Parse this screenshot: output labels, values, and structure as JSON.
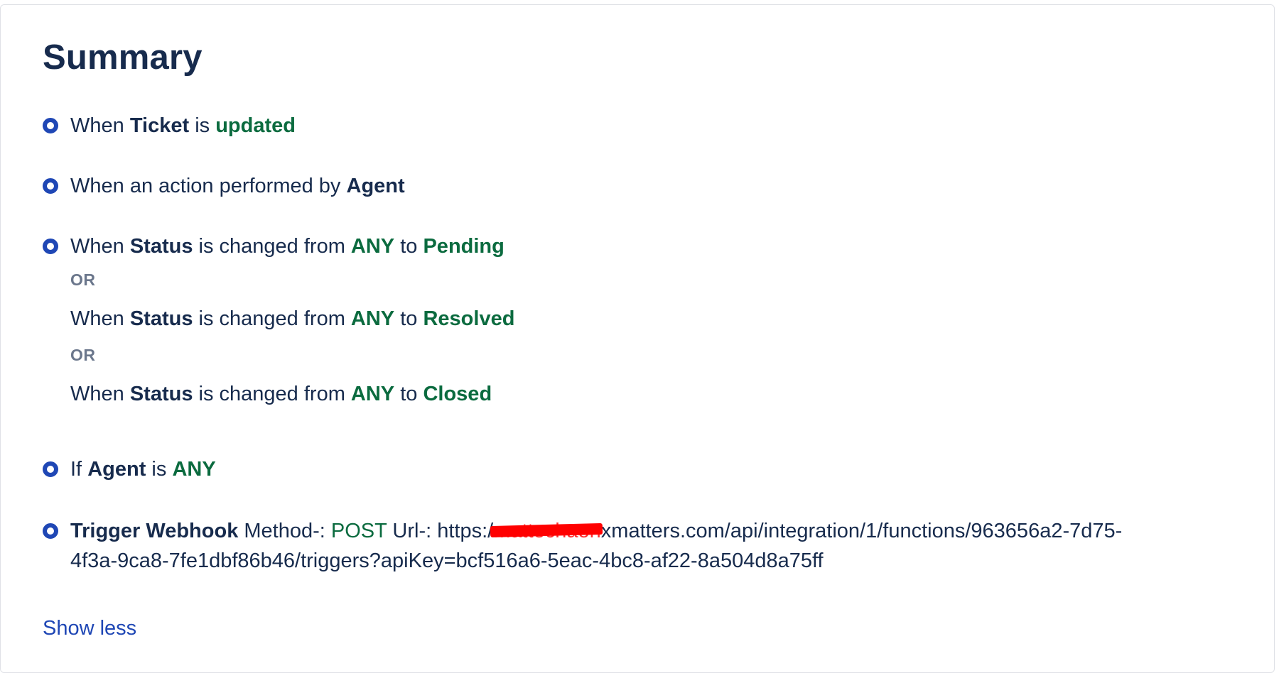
{
  "summary": {
    "title": "Summary",
    "rules": {
      "r1": {
        "when": "When",
        "object": "Ticket",
        "is": "is",
        "state": "updated"
      },
      "r2": {
        "text": "When an action performed by",
        "actor": "Agent"
      },
      "r3": {
        "c1": {
          "when": "When",
          "field": "Status",
          "mid": "is changed from",
          "from": "ANY",
          "to_word": "to",
          "to": "Pending"
        },
        "or1": "OR",
        "c2": {
          "when": "When",
          "field": "Status",
          "mid": "is changed from",
          "from": "ANY",
          "to_word": "to",
          "to": "Resolved"
        },
        "or2": "OR",
        "c3": {
          "when": "When",
          "field": "Status",
          "mid": "is changed from",
          "from": "ANY",
          "to_word": "to",
          "to": "Closed"
        }
      },
      "r4": {
        "if": "If",
        "field": "Agent",
        "is": "is",
        "value": "ANY"
      },
      "r5": {
        "action": "Trigger Webhook",
        "method_label": "Method-:",
        "method": "POST",
        "url_label": "Url-:",
        "url_prefix": "https:/",
        "url_redacted": "mattechaon",
        "url_rest": "xmatters.com/api/integration/1/functions/963656a2-7d75-4f3a-9ca8-7fe1dbf86b46/triggers?apiKey=bcf516a6-5eac-4bc8-af22-8a504d8a75ff"
      }
    },
    "show_less": "Show less"
  },
  "colors": {
    "accent_blue": "#1f47b5",
    "value_green": "#0b6b3f",
    "redaction": "#ff0000"
  }
}
